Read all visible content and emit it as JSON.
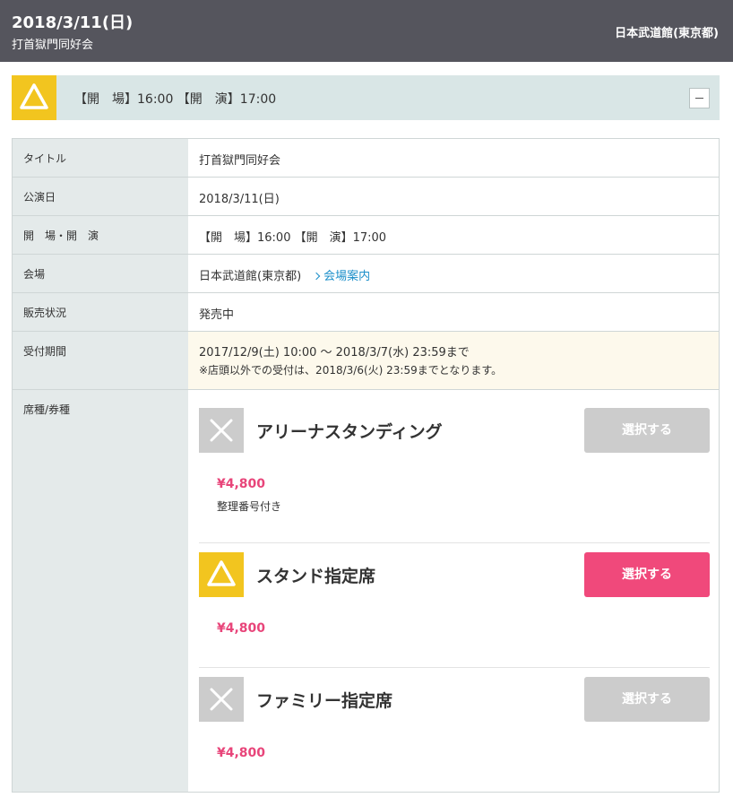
{
  "header": {
    "date": "2018/3/11(日)",
    "subtitle": "打首獄門同好会",
    "venue": "日本武道館(東京都)"
  },
  "banner": {
    "status_icon": "triangle-icon",
    "times": "【開　場】16:00 【開　演】17:00",
    "collapse_icon": "minus-icon"
  },
  "details": {
    "title_label": "タイトル",
    "title_value": "打首獄門同好会",
    "date_label": "公演日",
    "date_value": "2018/3/11(日)",
    "open_label": "開　場・開　演",
    "open_value": "【開　場】16:00 【開　演】17:00",
    "venue_label": "会場",
    "venue_value": "日本武道館(東京都)",
    "venue_link": "会場案内",
    "sales_label": "販売状況",
    "sales_value": "発売中",
    "period_label": "受付期間",
    "period_line1": "2017/12/9(土) 10:00 ～ 2018/3/7(水) 23:59まで",
    "period_line2": "※店頭以外での受付は、2018/3/6(火) 23:59までとなります。",
    "seat_label": "席種/券種"
  },
  "tickets": [
    {
      "name": "アリーナスタンディング",
      "status_icon": "x-icon",
      "price": "¥4,800",
      "note": "整理番号付き",
      "button": "選択する",
      "enabled": false
    },
    {
      "name": "スタンド指定席",
      "status_icon": "triangle-icon",
      "price": "¥4,800",
      "note": "",
      "button": "選択する",
      "enabled": true
    },
    {
      "name": "ファミリー指定席",
      "status_icon": "x-icon",
      "price": "¥4,800",
      "note": "",
      "button": "選択する",
      "enabled": false
    }
  ],
  "colors": {
    "header_bg": "#55555d",
    "accent_yellow": "#f2c51f",
    "select_enabled": "#f0497b",
    "select_disabled": "#cccccc",
    "price": "#e8457a",
    "link": "#1a8ec9"
  }
}
